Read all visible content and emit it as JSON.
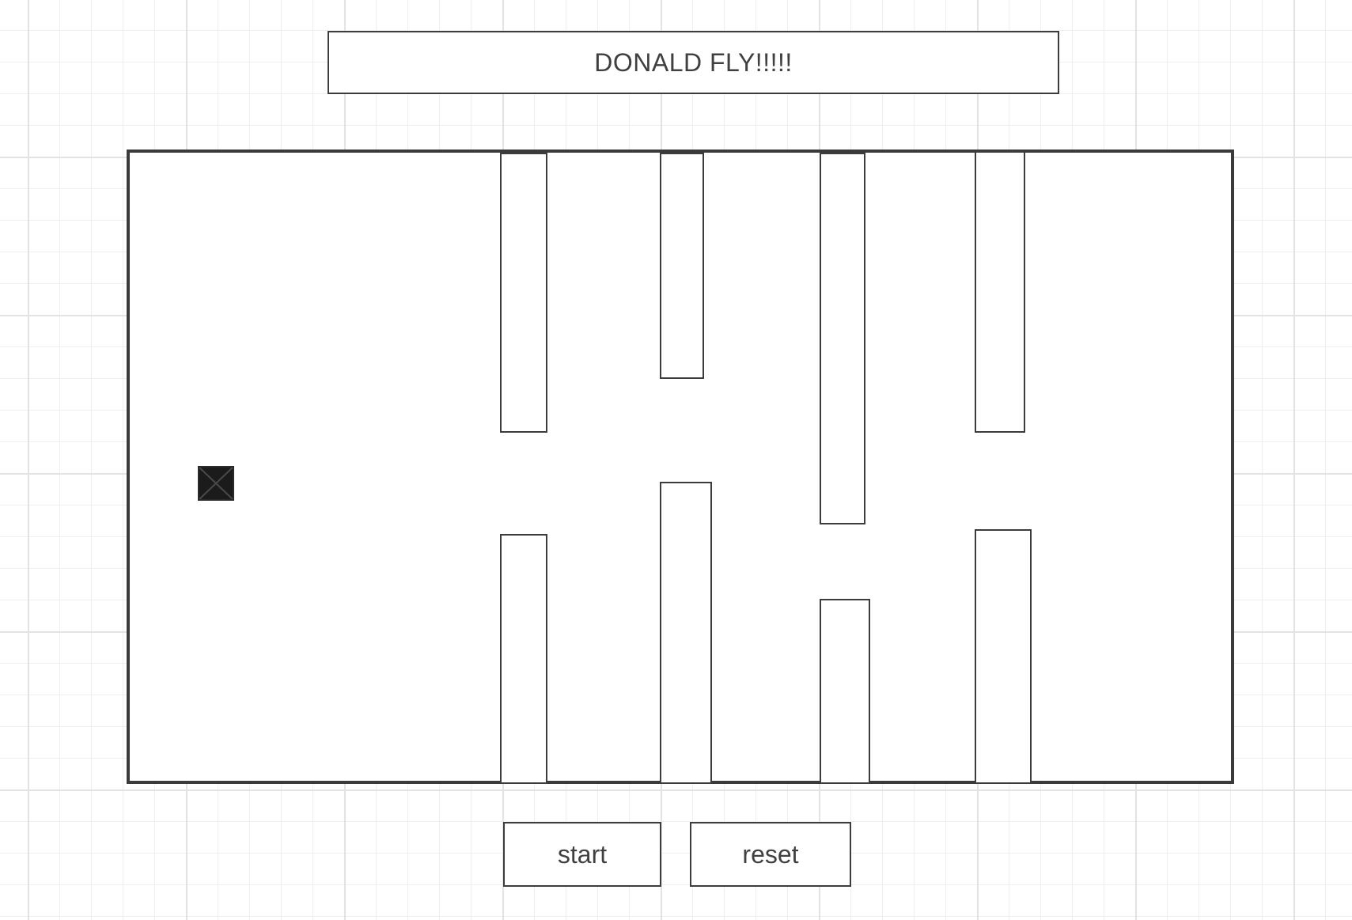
{
  "header": {
    "title": "DONALD FLY!!!!!"
  },
  "controls": {
    "start_label": "start",
    "reset_label": "reset"
  },
  "player": {
    "icon": "x-box-icon",
    "color": "#1b1b1b"
  },
  "colors": {
    "border": "#3c3c3c",
    "background": "#ffffff",
    "grid": "#e3e3e3"
  }
}
